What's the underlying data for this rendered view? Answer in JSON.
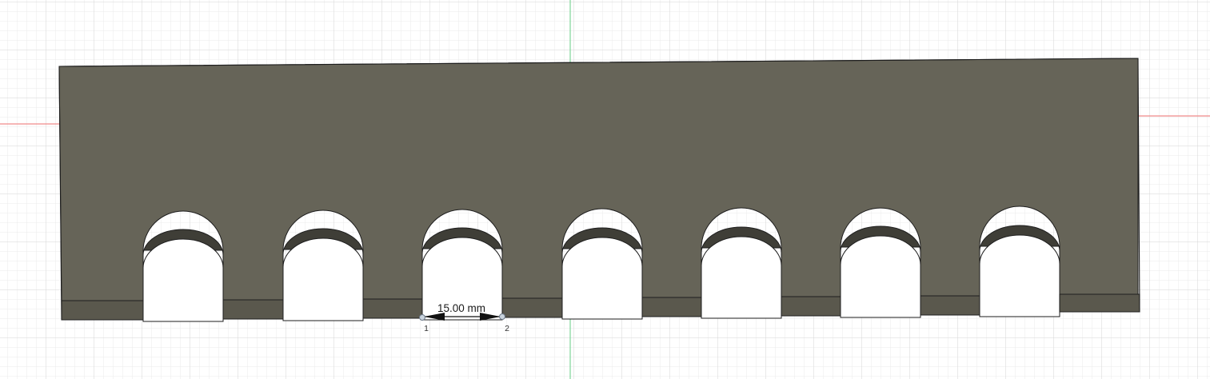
{
  "viewport": {
    "background": "#ffffff",
    "grid_minor_color": "#ebebeb",
    "grid_major_color": "#d6d6d6",
    "axis_x_color": "#f08a8a",
    "axis_y_color": "#7fd49a"
  },
  "part": {
    "face_color": "#666458",
    "side_color": "#5a584d",
    "slot_wall_color": "#3f3e37",
    "slot_interior_color": "#ffffff",
    "edge_color": "#1e1e1e",
    "slot_count": 7
  },
  "measurement": {
    "value_text": "15.00 mm",
    "point_1_label": "1",
    "point_2_label": "2",
    "color": "#111111"
  }
}
